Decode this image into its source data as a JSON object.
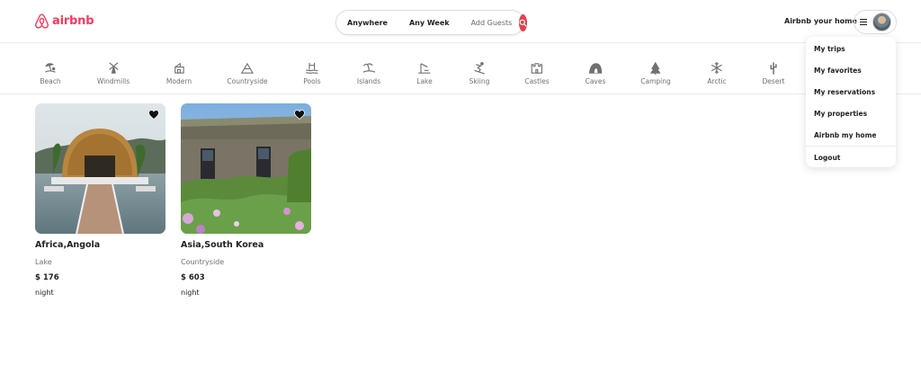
{
  "brand": {
    "name": "airbnb",
    "color": "#ff385c"
  },
  "search": {
    "where": "Anywhere",
    "when": "Any Week",
    "guests": "Add Guests",
    "button_icon": "search-icon",
    "button_color": "#e0424f"
  },
  "header": {
    "host_link": "Airbnb your home",
    "menu_icon": "hamburger-icon"
  },
  "categories": [
    {
      "label": "Beach",
      "icon": "beach-icon"
    },
    {
      "label": "Windmills",
      "icon": "windmill-icon"
    },
    {
      "label": "Modern",
      "icon": "modern-house-icon"
    },
    {
      "label": "Countryside",
      "icon": "mountain-icon"
    },
    {
      "label": "Pools",
      "icon": "pool-icon"
    },
    {
      "label": "Islands",
      "icon": "island-icon"
    },
    {
      "label": "Lake",
      "icon": "lake-icon"
    },
    {
      "label": "Skiing",
      "icon": "skiing-icon"
    },
    {
      "label": "Castles",
      "icon": "castle-icon"
    },
    {
      "label": "Caves",
      "icon": "cave-icon"
    },
    {
      "label": "Camping",
      "icon": "camping-icon"
    },
    {
      "label": "Arctic",
      "icon": "snowflake-icon"
    },
    {
      "label": "Desert",
      "icon": "cactus-icon"
    }
  ],
  "user_menu": {
    "items": [
      "My trips",
      "My favorites",
      "My reservations",
      "My properties",
      "Airbnb my home",
      "Logout"
    ]
  },
  "listings": [
    {
      "title": "Africa,Angola",
      "category": "Lake",
      "price": "$ 176",
      "unit": "night",
      "favorited": true
    },
    {
      "title": "Asia,South Korea",
      "category": "Countryside",
      "price": "$ 603",
      "unit": "night",
      "favorited": true
    }
  ]
}
